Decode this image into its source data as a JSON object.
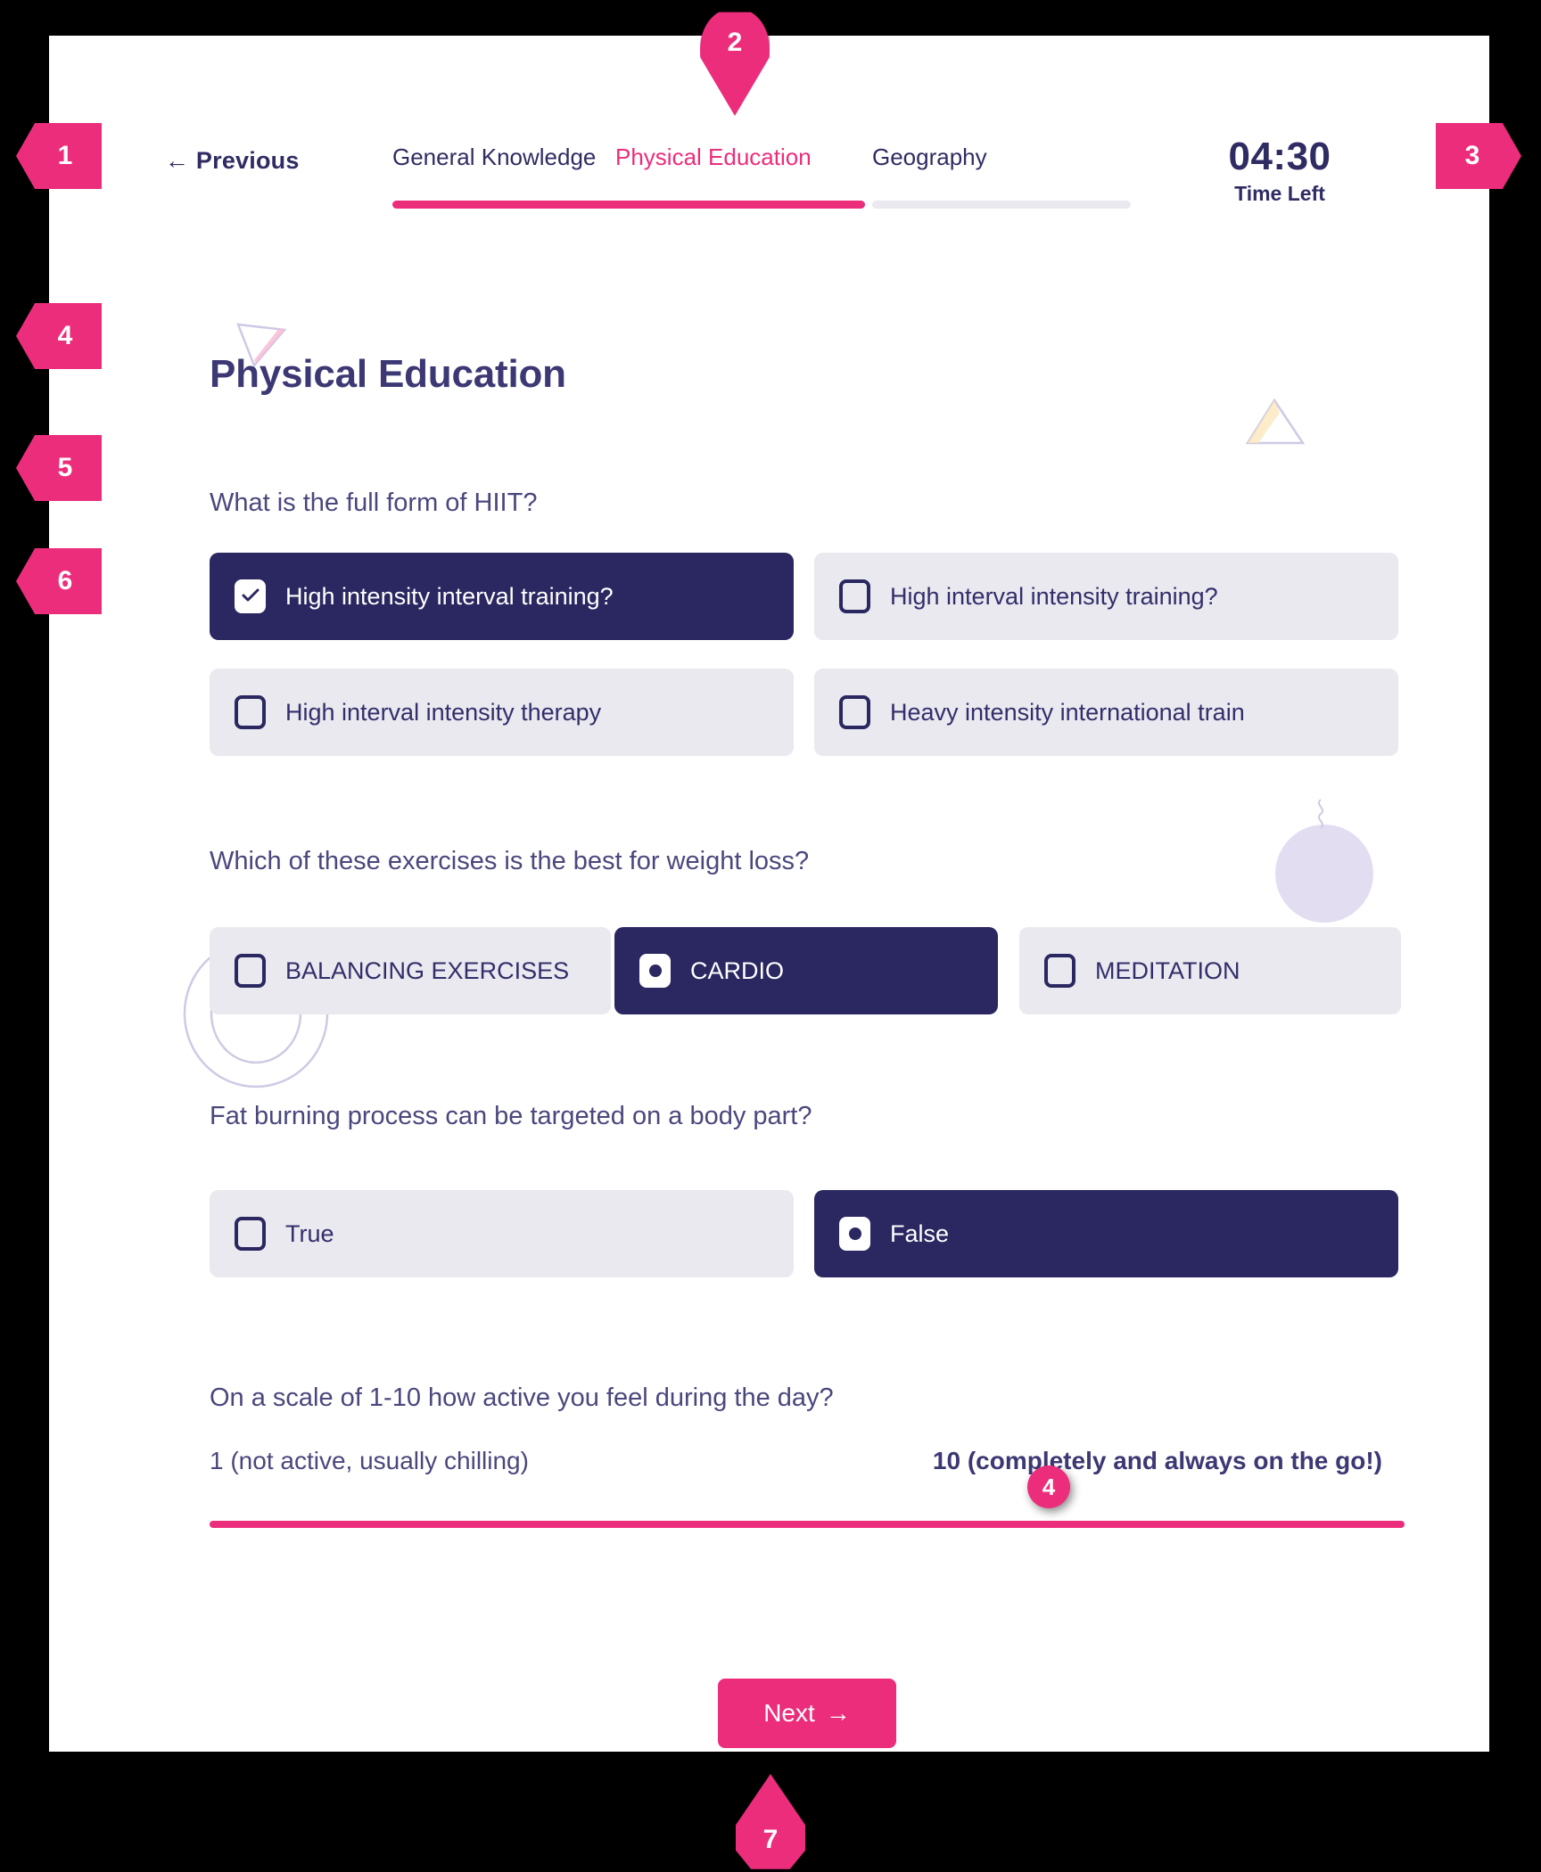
{
  "header": {
    "previous_label": "← Previous",
    "previous_arrow": "←",
    "tabs": [
      {
        "label": "General Knowledge",
        "state": "done"
      },
      {
        "label": "Physical Education",
        "state": "active"
      },
      {
        "label": "Geography",
        "state": "upcoming"
      }
    ],
    "timer": {
      "value": "04:30",
      "label": "Time Left"
    }
  },
  "page_title": "Physical Education",
  "questions": [
    {
      "text": "What is the full form of HIIT?",
      "type": "checkbox",
      "options": [
        {
          "label": "High intensity interval training?",
          "selected": true
        },
        {
          "label": "High interval intensity training?",
          "selected": false
        },
        {
          "label": "High interval intensity therapy",
          "selected": false
        },
        {
          "label": "Heavy intensity international train",
          "selected": false
        }
      ]
    },
    {
      "text": "Which of these exercises is the best for weight loss?",
      "type": "radio",
      "options": [
        {
          "label": "BALANCING EXERCISES",
          "selected": false
        },
        {
          "label": "CARDIO",
          "selected": true
        },
        {
          "label": "MEDITATION",
          "selected": false
        }
      ]
    },
    {
      "text": "Fat burning process can be targeted on a body part?",
      "type": "radio",
      "options": [
        {
          "label": "True",
          "selected": false
        },
        {
          "label": "False",
          "selected": true
        }
      ]
    },
    {
      "text": "On a scale of 1-10 how active you feel during the day?",
      "type": "slider",
      "scale_low_label": "1 (not active, usually chilling)",
      "scale_high_label": "10 (completely and always on the go!)",
      "slider_value": "",
      "slider_min": "1",
      "slider_max": "10"
    }
  ],
  "next_button": {
    "label": "Next",
    "arrow": "→"
  },
  "annotations": [
    {
      "id": "1",
      "label": "1"
    },
    {
      "id": "2",
      "label": "2"
    },
    {
      "id": "3",
      "label": "3"
    },
    {
      "id": "4",
      "label": "4"
    },
    {
      "id": "5",
      "label": "5"
    },
    {
      "id": "6",
      "label": "6"
    },
    {
      "id": "7",
      "label": "7"
    },
    {
      "id": "slider",
      "label": "4"
    }
  ],
  "colors": {
    "accent_pink": "#ec2d7b",
    "navy": "#2a2761",
    "option_bg": "#e9e9ef",
    "text_navy": "#3c3874"
  }
}
